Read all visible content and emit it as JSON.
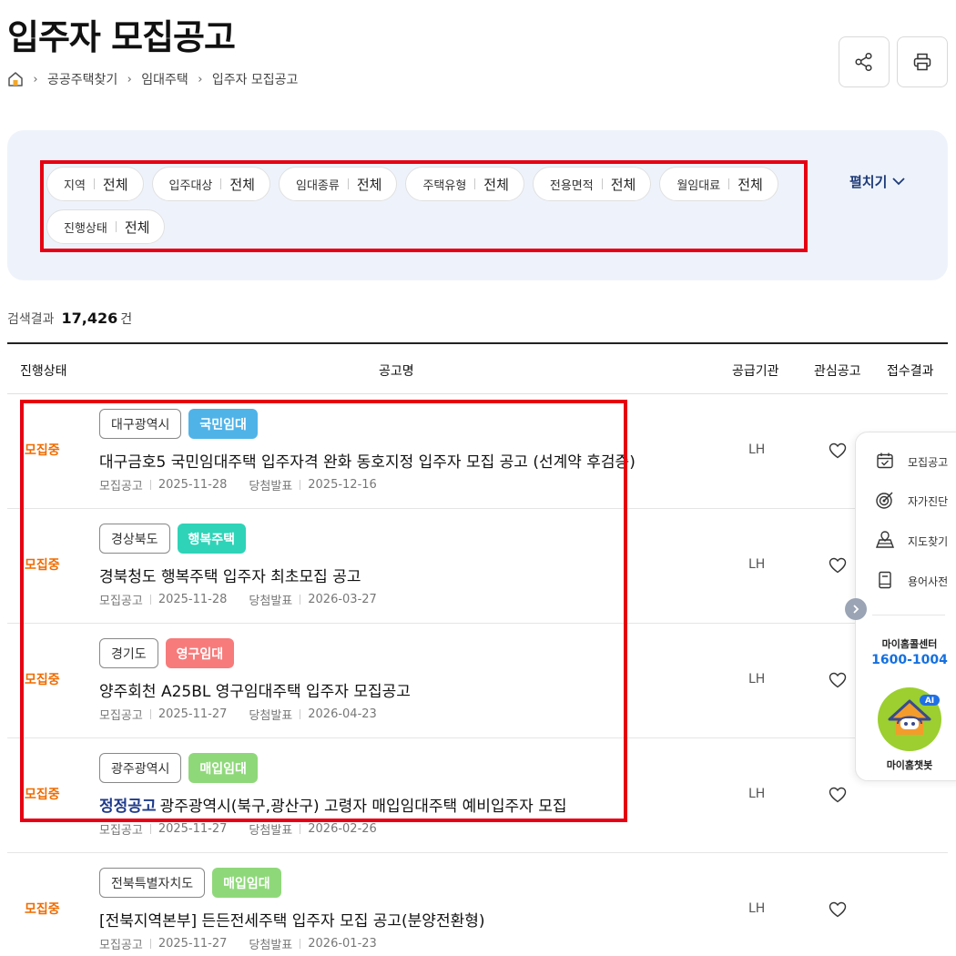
{
  "page": {
    "title": "입주자 모집공고"
  },
  "breadcrumb": {
    "home_icon": "home-icon",
    "items": [
      "공공주택찾기",
      "임대주택",
      "입주자 모집공고"
    ]
  },
  "header_actions": {
    "share_icon": "share-icon",
    "print_icon": "print-icon"
  },
  "filters": {
    "chips": [
      {
        "label": "지역",
        "value": "전체"
      },
      {
        "label": "입주대상",
        "value": "전체"
      },
      {
        "label": "임대종류",
        "value": "전체"
      },
      {
        "label": "주택유형",
        "value": "전체"
      },
      {
        "label": "전용면적",
        "value": "전체"
      },
      {
        "label": "월임대료",
        "value": "전체"
      },
      {
        "label": "진행상태",
        "value": "전체"
      }
    ],
    "expand_label": "펼치기"
  },
  "results": {
    "label": "검색결과",
    "count": "17,426",
    "unit": "건"
  },
  "table": {
    "headers": {
      "status": "진행상태",
      "title": "공고명",
      "org": "공급기관",
      "favorite": "관심공고",
      "result": "접수결과"
    },
    "rows": [
      {
        "status": "모집중",
        "region": "대구광역시",
        "type": "국민임대",
        "type_color": "#4fb3e8",
        "correction": "",
        "title": "대구금호5 국민임대주택 입주자격 완화 동호지정 입주자 모집 공고 (선계약 후검증)",
        "notice_label": "모집공고",
        "notice_date": "2025-11-28",
        "winner_label": "당첨발표",
        "winner_date": "2025-12-16",
        "org": "LH"
      },
      {
        "status": "모집중",
        "region": "경상북도",
        "type": "행복주택",
        "type_color": "#2fd3b8",
        "correction": "",
        "title": "경북청도 행복주택 입주자 최초모집 공고",
        "notice_label": "모집공고",
        "notice_date": "2025-11-28",
        "winner_label": "당첨발표",
        "winner_date": "2026-03-27",
        "org": "LH"
      },
      {
        "status": "모집중",
        "region": "경기도",
        "type": "영구임대",
        "type_color": "#f77b7b",
        "correction": "",
        "title": "양주회천 A25BL 영구임대주택 입주자 모집공고",
        "notice_label": "모집공고",
        "notice_date": "2025-11-27",
        "winner_label": "당첨발표",
        "winner_date": "2026-04-23",
        "org": "LH"
      },
      {
        "status": "모집중",
        "region": "광주광역시",
        "type": "매입임대",
        "type_color": "#8fd87a",
        "correction": "정정공고",
        "title": "광주광역시(북구,광산구) 고령자 매입임대주택 예비입주자 모집",
        "notice_label": "모집공고",
        "notice_date": "2025-11-27",
        "winner_label": "당첨발표",
        "winner_date": "2026-02-26",
        "org": "LH"
      },
      {
        "status": "모집중",
        "region": "전북특별자치도",
        "type": "매입임대",
        "type_color": "#8fd87a",
        "correction": "",
        "title": "[전북지역본부] 든든전세주택 입주자 모집 공고(분양전환형)",
        "notice_label": "모집공고",
        "notice_date": "2025-11-27",
        "winner_label": "당첨발표",
        "winner_date": "2026-01-23",
        "org": "LH"
      }
    ]
  },
  "quick_menu": {
    "items": [
      {
        "label": "모집공고",
        "icon": "calendar-check-icon"
      },
      {
        "label": "자가진단",
        "icon": "target-icon"
      },
      {
        "label": "지도찾기",
        "icon": "map-icon"
      },
      {
        "label": "용어사전",
        "icon": "book-icon"
      }
    ],
    "center_label": "마이홈콜센터",
    "phone": "1600-1004",
    "bot_badge": "AI",
    "bot_label": "마이홈챗봇"
  }
}
